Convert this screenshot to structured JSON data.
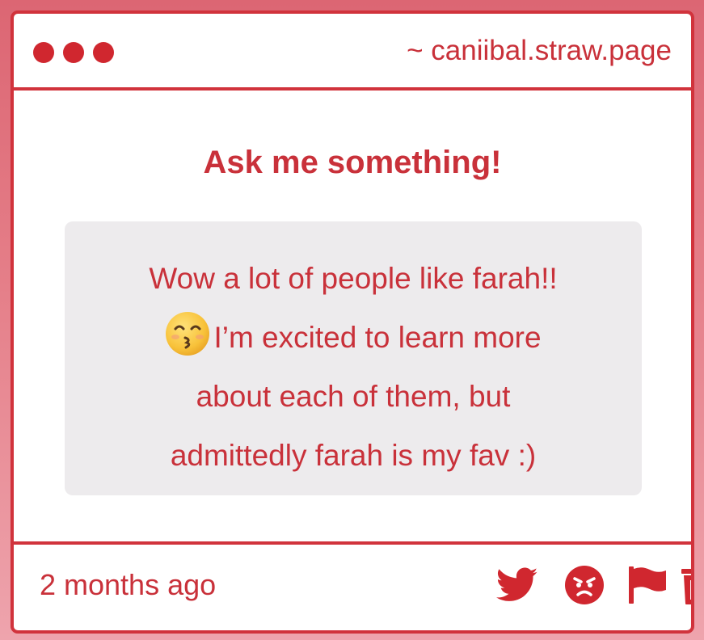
{
  "window": {
    "url": "~ caniibal.straw.page"
  },
  "main": {
    "heading": "Ask me something!",
    "question": {
      "line1": "Wow a lot of people like farah!!",
      "emoji": "kissing-face-with-smiling-eyes",
      "line2": "I’m excited to learn more",
      "line3": "about each of them, but",
      "line4": "admittedly farah is my fav :)"
    }
  },
  "footer": {
    "timestamp": "2 months ago",
    "actions": [
      {
        "icon": "twitter-icon"
      },
      {
        "icon": "angry-face-icon"
      },
      {
        "icon": "flag-icon"
      },
      {
        "icon": "trash-icon"
      }
    ]
  },
  "colors": {
    "accent": "#d1333c",
    "text": "#c9313a",
    "question_bg": "#edebed",
    "page_bg_top": "#dc6673",
    "page_bg_bottom": "#eea4ad"
  }
}
